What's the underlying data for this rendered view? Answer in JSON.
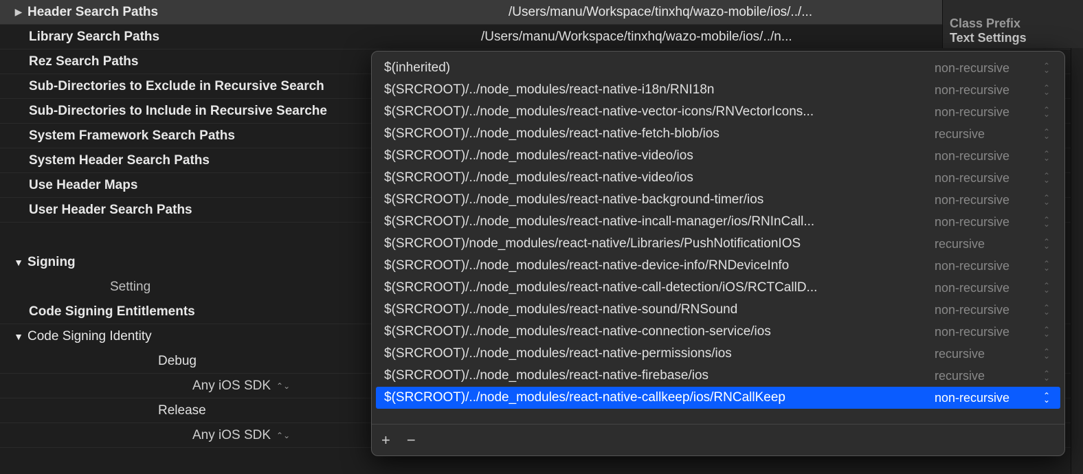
{
  "settings": {
    "rows": [
      {
        "label": "Header Search Paths",
        "value": "/Users/manu/Workspace/tinxhq/wazo-mobile/ios/../...",
        "selected": true,
        "disclosure": "right"
      },
      {
        "label": "Library Search Paths",
        "value": "/Users/manu/Workspace/tinxhq/wazo-mobile/ios/../n...",
        "selected": false
      },
      {
        "label": "Rez Search Paths",
        "value": "",
        "selected": false
      },
      {
        "label": "Sub-Directories to Exclude in Recursive Search",
        "value": "",
        "selected": false
      },
      {
        "label": "Sub-Directories to Include in Recursive Searche",
        "value": "",
        "selected": false
      },
      {
        "label": "System Framework Search Paths",
        "value": "",
        "selected": false
      },
      {
        "label": "System Header Search Paths",
        "value": "",
        "selected": false
      },
      {
        "label": "Use Header Maps",
        "value": "",
        "selected": false
      },
      {
        "label": "User Header Search Paths",
        "value": "",
        "selected": false
      }
    ],
    "signing": {
      "section_label": "Signing",
      "setting_label": "Setting",
      "entitlements_label": "Code Signing Entitlements",
      "identity_label": "Code Signing Identity",
      "debug_label": "Debug",
      "release_label": "Release",
      "any_sdk_label": "Any iOS SDK"
    }
  },
  "right_sidebar": {
    "top_cutoff": "Class Prefix",
    "bottom_cutoff": "Text Settings"
  },
  "popover": {
    "entries": [
      {
        "path": "$(inherited)",
        "recursion": "non-recursive"
      },
      {
        "path": "$(SRCROOT)/../node_modules/react-native-i18n/RNI18n",
        "recursion": "non-recursive"
      },
      {
        "path": "$(SRCROOT)/../node_modules/react-native-vector-icons/RNVectorIcons...",
        "recursion": "non-recursive"
      },
      {
        "path": "$(SRCROOT)/../node_modules/react-native-fetch-blob/ios",
        "recursion": "recursive"
      },
      {
        "path": "$(SRCROOT)/../node_modules/react-native-video/ios",
        "recursion": "non-recursive"
      },
      {
        "path": "$(SRCROOT)/../node_modules/react-native-video/ios",
        "recursion": "non-recursive"
      },
      {
        "path": "$(SRCROOT)/../node_modules/react-native-background-timer/ios",
        "recursion": "non-recursive"
      },
      {
        "path": "$(SRCROOT)/../node_modules/react-native-incall-manager/ios/RNInCall...",
        "recursion": "non-recursive"
      },
      {
        "path": "$(SRCROOT)/node_modules/react-native/Libraries/PushNotificationIOS",
        "recursion": "recursive"
      },
      {
        "path": "$(SRCROOT)/../node_modules/react-native-device-info/RNDeviceInfo",
        "recursion": "non-recursive"
      },
      {
        "path": "$(SRCROOT)/../node_modules/react-native-call-detection/iOS/RCTCallD...",
        "recursion": "non-recursive"
      },
      {
        "path": "$(SRCROOT)/../node_modules/react-native-sound/RNSound",
        "recursion": "non-recursive"
      },
      {
        "path": "$(SRCROOT)/../node_modules/react-native-connection-service/ios",
        "recursion": "non-recursive"
      },
      {
        "path": "$(SRCROOT)/../node_modules/react-native-permissions/ios",
        "recursion": "recursive"
      },
      {
        "path": "$(SRCROOT)/../node_modules/react-native-firebase/ios",
        "recursion": "recursive"
      },
      {
        "path": "$(SRCROOT)/../node_modules/react-native-callkeep/ios/RNCallKeep",
        "recursion": "non-recursive",
        "selected": true
      }
    ],
    "footer": {
      "plus": "+",
      "minus": "−"
    }
  }
}
